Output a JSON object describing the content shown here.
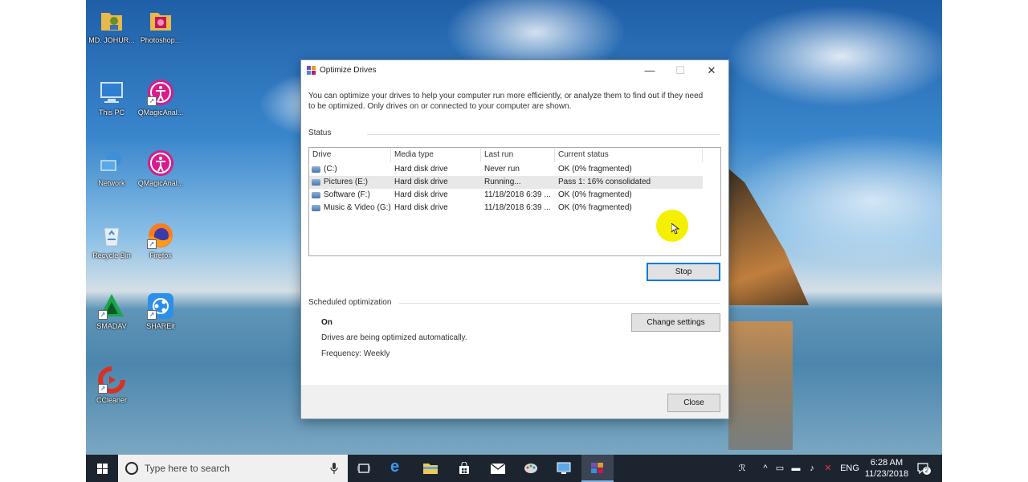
{
  "desktop": {
    "icons": [
      {
        "label": "MD. JOHUR...",
        "icon": "user-folder-icon"
      },
      {
        "label": "Photoshop...",
        "icon": "photoshop-folder-icon"
      },
      {
        "label": "This PC",
        "icon": "computer-icon"
      },
      {
        "label": "QMagicAnal...",
        "icon": "accessibility-app-icon"
      },
      {
        "label": "Network",
        "icon": "network-icon"
      },
      {
        "label": "QMagicAnal...",
        "icon": "accessibility-app-icon"
      },
      {
        "label": "Recycle Bin",
        "icon": "recycle-bin-icon"
      },
      {
        "label": "Firefox",
        "icon": "firefox-icon"
      },
      {
        "label": "SMADAV",
        "icon": "smadav-icon"
      },
      {
        "label": "SHAREit",
        "icon": "shareit-icon"
      },
      {
        "label": "CCleaner",
        "icon": "ccleaner-icon"
      }
    ]
  },
  "dialog": {
    "title": "Optimize Drives",
    "intro": "You can optimize your drives to help your computer run more efficiently, or analyze them to find out if they need to be optimized. Only drives on or connected to your computer are shown.",
    "status_label": "Status",
    "columns": [
      "Drive",
      "Media type",
      "Last run",
      "Current status"
    ],
    "drives": [
      {
        "drive": "(C:)",
        "media": "Hard disk drive",
        "last_run": "Never run",
        "status": "OK (0% fragmented)"
      },
      {
        "drive": "Pictures (E:)",
        "media": "Hard disk drive",
        "last_run": "Running...",
        "status": "Pass 1: 16% consolidated"
      },
      {
        "drive": "Software (F:)",
        "media": "Hard disk drive",
        "last_run": "11/18/2018 6:39 ...",
        "status": "OK (0% fragmented)"
      },
      {
        "drive": "Music & Video (G:)",
        "media": "Hard disk drive",
        "last_run": "11/18/2018 6:39 ...",
        "status": "OK (0% fragmented)"
      }
    ],
    "stop_label": "Stop",
    "scheduled_label": "Scheduled optimization",
    "schedule_state": "On",
    "schedule_desc": "Drives are being optimized automatically.",
    "schedule_freq": "Frequency: Weekly",
    "change_settings_label": "Change settings",
    "close_label": "Close"
  },
  "taskbar": {
    "search_placeholder": "Type here to search",
    "language": "ENG",
    "time": "6:28 AM",
    "date": "11/23/2018",
    "notification_count": "2"
  },
  "colors": {
    "accent": "#0078d7",
    "taskbar": "#1c2430",
    "cursor_highlight": "#f5f000"
  }
}
